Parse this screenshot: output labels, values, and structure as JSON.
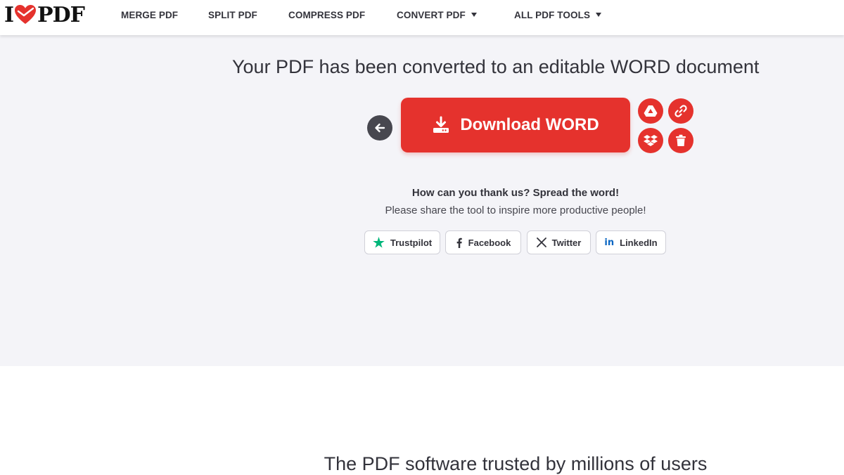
{
  "header": {
    "logo": {
      "left": "I",
      "right": "PDF"
    },
    "nav": [
      {
        "label": "MERGE PDF"
      },
      {
        "label": "SPLIT PDF"
      },
      {
        "label": "COMPRESS PDF"
      },
      {
        "label": "CONVERT PDF"
      },
      {
        "label": "ALL PDF TOOLS"
      }
    ]
  },
  "main": {
    "title": "Your PDF has been converted to an editable WORD document",
    "download_label": "Download WORD",
    "side_actions": [
      "google-drive-icon",
      "link-icon",
      "dropbox-icon",
      "trash-icon"
    ],
    "share_title": "How can you thank us? Spread the word!",
    "share_subtitle": "Please share the tool to inspire more productive people!",
    "share_buttons": [
      {
        "label": "Trustpilot"
      },
      {
        "label": "Facebook"
      },
      {
        "label": "Twitter"
      },
      {
        "label": "LinkedIn"
      }
    ]
  },
  "section2": {
    "title": "The PDF software trusted by millions of users"
  },
  "colors": {
    "brand_red": "#e5322d",
    "hero_bg": "#f4f4f8",
    "text_dark": "#33333b",
    "trustpilot_green": "#00b67a",
    "link_blue": "#0a66c2"
  }
}
